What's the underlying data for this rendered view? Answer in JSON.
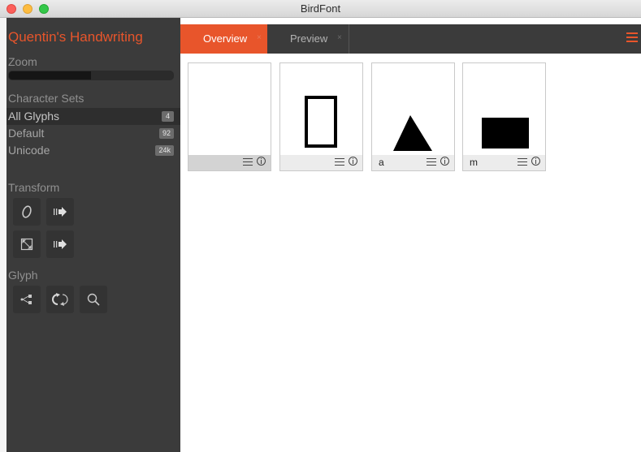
{
  "window": {
    "title": "BirdFont"
  },
  "sidebar": {
    "app_title": "Quentin's Handwriting",
    "zoom": {
      "label": "Zoom",
      "level": 0.5
    },
    "character_sets": {
      "label": "Character Sets",
      "items": [
        {
          "name": "All Glyphs",
          "count": "4",
          "active": true
        },
        {
          "name": "Default",
          "count": "92",
          "active": false
        },
        {
          "name": "Unicode",
          "count": "24k",
          "active": false
        }
      ]
    },
    "transform": {
      "label": "Transform",
      "tools": [
        "italic-icon",
        "arrow-right-icon",
        "resize-icon",
        "arrow-right-icon"
      ]
    },
    "glyph": {
      "label": "Glyph",
      "tools": [
        "merge-points-icon",
        "rotate-icon",
        "search-icon"
      ]
    }
  },
  "tabs": [
    {
      "label": "Overview",
      "close": "×",
      "active": true
    },
    {
      "label": "Preview",
      "close": "×",
      "active": false
    }
  ],
  "glyphs": [
    {
      "char": "",
      "shape": "empty",
      "selected": true
    },
    {
      "char": "",
      "shape": "rectangle-outline",
      "selected": false
    },
    {
      "char": "a",
      "shape": "triangle",
      "selected": false
    },
    {
      "char": "m",
      "shape": "rectangle-filled",
      "selected": false
    }
  ],
  "colors": {
    "accent": "#e8552b",
    "sidebar_bg": "#3b3b3b"
  }
}
